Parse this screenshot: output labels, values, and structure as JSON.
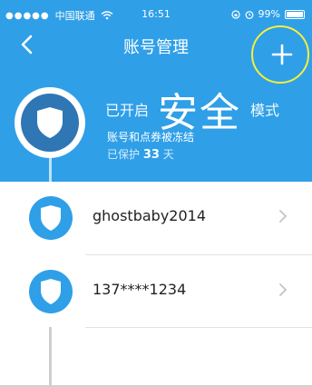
{
  "status_bar": {
    "carrier": "中国联通",
    "time": "16:51",
    "battery": "99%"
  },
  "nav": {
    "title": "账号管理"
  },
  "security": {
    "prefix": "已开启",
    "status": "安全",
    "suffix": "模式",
    "frozen_note": "账号和点券被冻结",
    "protected_prefix": "已保护",
    "protected_days": "33",
    "protected_unit": "天"
  },
  "accounts": [
    {
      "name": "ghostbaby2014"
    },
    {
      "name": "137****1234"
    }
  ],
  "colors": {
    "primary": "#2f9fe8",
    "shield_dark": "#2f76b5",
    "highlight_ring": "#f7ef3a"
  }
}
